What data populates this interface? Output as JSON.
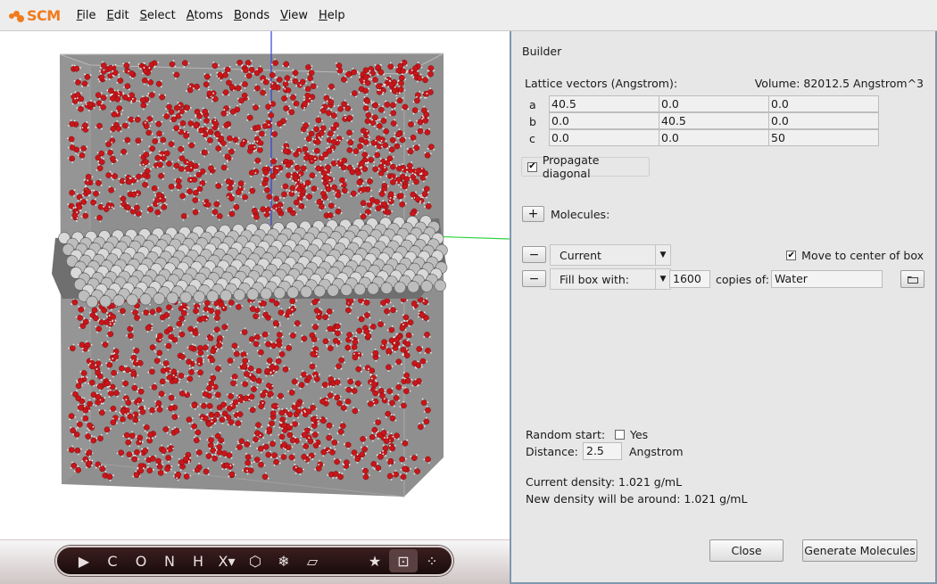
{
  "app": {
    "logo_text": "SCM",
    "brand_color": "#f07b1d"
  },
  "menubar": {
    "items": [
      {
        "u": "F",
        "rest": "ile"
      },
      {
        "u": "E",
        "rest": "dit"
      },
      {
        "u": "S",
        "rest": "elect"
      },
      {
        "u": "A",
        "rest": "toms"
      },
      {
        "u": "B",
        "rest": "onds"
      },
      {
        "u": "V",
        "rest": "iew"
      },
      {
        "u": "H",
        "rest": "elp"
      }
    ]
  },
  "toolbar": {
    "tools": [
      {
        "label": "▶",
        "icon": "pointer-select-icon"
      },
      {
        "label": "C",
        "icon": "carbon-atom-icon"
      },
      {
        "label": "O",
        "icon": "oxygen-atom-icon"
      },
      {
        "label": "N",
        "icon": "nitrogen-atom-icon"
      },
      {
        "label": "H",
        "icon": "hydrogen-atom-icon"
      },
      {
        "label": "X▾",
        "icon": "other-element-icon"
      },
      {
        "label": "⬡",
        "icon": "ring-icon"
      },
      {
        "label": "❄",
        "icon": "crystal-icon"
      },
      {
        "label": "▱",
        "icon": "slab-icon"
      },
      {
        "label": "★",
        "icon": "favorites-star-icon"
      },
      {
        "label": "⊡",
        "icon": "builder-box-icon"
      },
      {
        "label": "⁘",
        "icon": "more-tools-icon"
      }
    ]
  },
  "builder": {
    "title": "Builder",
    "lattice_label": "Lattice vectors (Angstrom):",
    "volume_label": "Volume: 82012.5 Angstrom^3",
    "lattice": [
      {
        "name": "a",
        "values": [
          "40.5",
          "0.0",
          "0.0"
        ]
      },
      {
        "name": "b",
        "values": [
          "0.0",
          "40.5",
          "0.0"
        ]
      },
      {
        "name": "c",
        "values": [
          "0.0",
          "0.0",
          "50"
        ]
      }
    ],
    "propagate_label": "Propagate diagonal",
    "propagate_checked": "✔",
    "add_label": "+",
    "molecules_label": "Molecules:",
    "remove_label": "−",
    "row1_combo": "Current",
    "move_center_label": "Move to center of box",
    "move_center_checked": "✔",
    "row2_combo": "Fill box with:",
    "copies_value": "1600",
    "copies_label": "copies of:",
    "molecule_value": "Water",
    "random_start_label": "Random start:",
    "random_yes_label": "Yes",
    "distance_label": "Distance:",
    "distance_value": "2.5",
    "distance_unit": "Angstrom",
    "current_density": "Current density: 1.021 g/mL",
    "new_density": "New density will be around: 1.021 g/mL",
    "close_label": "Close",
    "generate_label": "Generate Molecules"
  }
}
